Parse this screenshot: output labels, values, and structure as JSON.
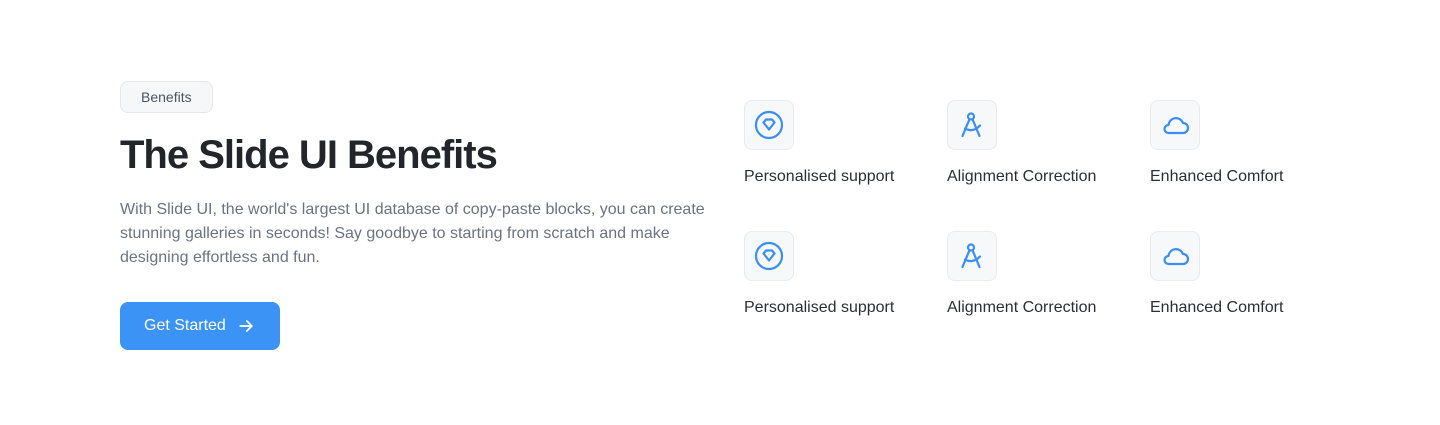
{
  "hero": {
    "badge": "Benefits",
    "title": "The Slide UI Benefits",
    "description": "With Slide UI, the world's largest UI database of copy-paste blocks, you can create stunning galleries in seconds! Say goodbye to starting from scratch and make designing effortless and fun.",
    "cta_label": "Get Started",
    "cta_icon": "arrow-right-icon"
  },
  "benefits": [
    {
      "label": "Personalised support",
      "icon": "diamond-icon"
    },
    {
      "label": "Alignment Correction",
      "icon": "compass-icon"
    },
    {
      "label": "Enhanced Comfort",
      "icon": "cloud-icon"
    },
    {
      "label": "Personalised support",
      "icon": "diamond-icon"
    },
    {
      "label": "Alignment Correction",
      "icon": "compass-icon"
    },
    {
      "label": "Enhanced Comfort",
      "icon": "cloud-icon"
    }
  ],
  "colors": {
    "accent": "#3b93f5",
    "icon": "#3b8ff0",
    "text": "#22262b",
    "muted": "#6b7280"
  }
}
